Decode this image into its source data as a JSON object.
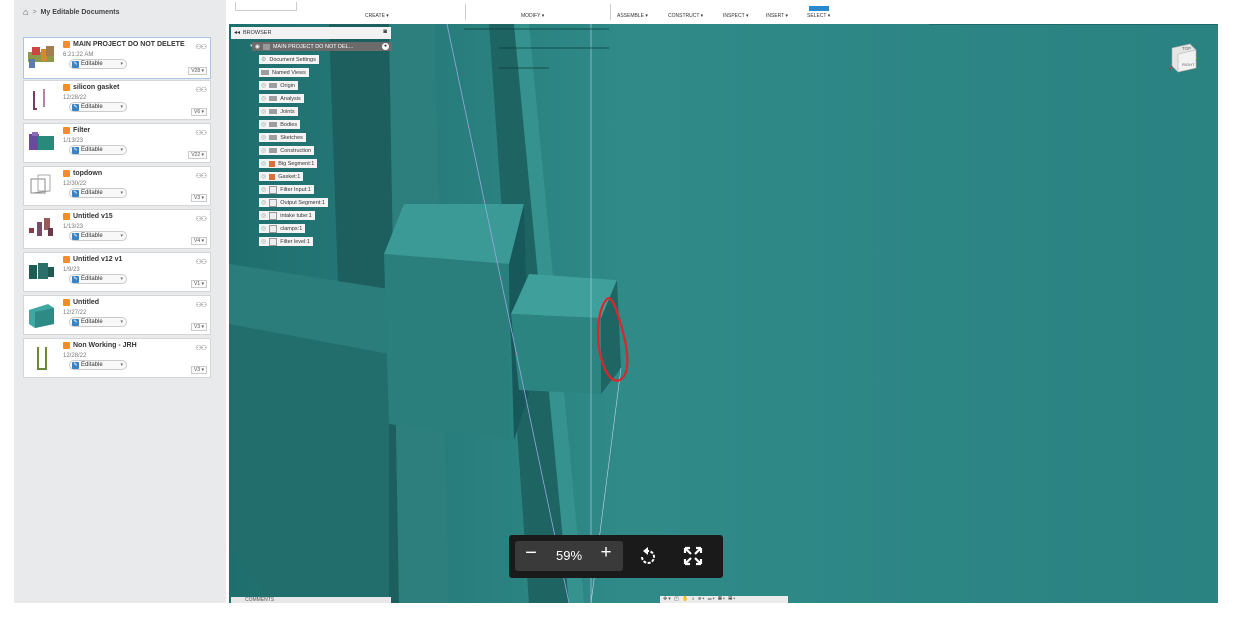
{
  "sidebar": {
    "breadcrumb": {
      "home_icon": "home-icon",
      "separator": ">",
      "title": "My Editable Documents"
    },
    "documents": [
      {
        "title": "MAIN PROJECT DO NOT DELETE",
        "date": "6:21:22 AM",
        "status": "Editable",
        "version": "V28 ▾"
      },
      {
        "title": "silicon gasket",
        "date": "12/28/22",
        "status": "Editable",
        "version": "V6 ▾"
      },
      {
        "title": "Filter",
        "date": "1/13/23",
        "status": "Editable",
        "version": "V22 ▾"
      },
      {
        "title": "topdown",
        "date": "12/30/22",
        "status": "Editable",
        "version": "V3 ▾"
      },
      {
        "title": "Untitled v15",
        "date": "1/13/23",
        "status": "Editable",
        "version": "V4 ▾"
      },
      {
        "title": "Untitled v12 v1",
        "date": "1/9/23",
        "status": "Editable",
        "version": "V1 ▾"
      },
      {
        "title": "Untitled",
        "date": "12/27/22",
        "status": "Editable",
        "version": "V3 ▾"
      },
      {
        "title": "Non Working - JRH",
        "date": "12/28/22",
        "status": "Editable",
        "version": "V3 ▾"
      }
    ]
  },
  "toolbar": {
    "groups": [
      "CREATE ▾",
      "MODIFY ▾",
      "ASSEMBLE ▾",
      "CONSTRUCT ▾",
      "INSPECT ▾",
      "INSERT ▾",
      "SELECT ▾"
    ]
  },
  "browser": {
    "header": "BROWSER",
    "root": "MAIN PROJECT DO NOT DEL...",
    "items": [
      "Document Settings",
      "Named Views",
      "Origin",
      "Analysis",
      "Joints",
      "Bodies",
      "Sketches",
      "Construction",
      "Big Segment:1",
      "Gasket:1",
      "Filter Input:1",
      "Output Segment:1",
      "intake tube:1",
      "clamps:1",
      "Filter level:1"
    ]
  },
  "viewcube": {
    "top": "TOP",
    "right": "RIGHT"
  },
  "comments": {
    "label": "COMMENTS"
  },
  "zoom": {
    "minus": "−",
    "value": "59%",
    "plus": "+"
  },
  "colors": {
    "viewport": "#2b8181",
    "annotation": "#e0242b"
  }
}
